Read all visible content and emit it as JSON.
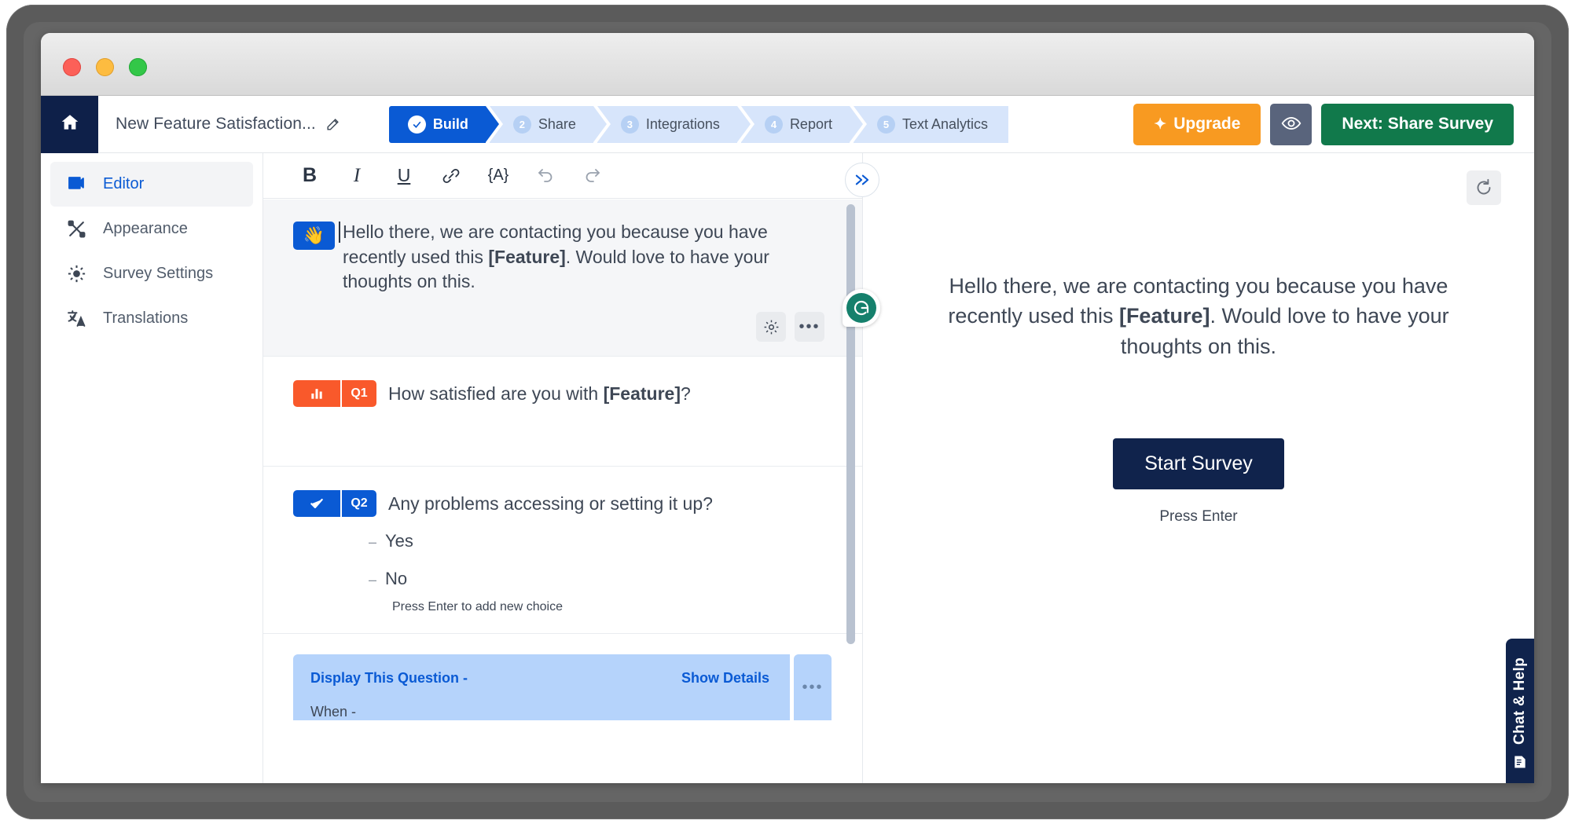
{
  "window": {
    "traffic_lights": [
      "close",
      "minimize",
      "maximize"
    ]
  },
  "header": {
    "home_icon": "home-icon",
    "survey_title": "New Feature Satisfaction...",
    "edit_icon": "pencil-icon",
    "steps": [
      {
        "num": "1",
        "label": "Build",
        "state": "complete"
      },
      {
        "num": "2",
        "label": "Share",
        "state": "pending"
      },
      {
        "num": "3",
        "label": "Integrations",
        "state": "pending"
      },
      {
        "num": "4",
        "label": "Report",
        "state": "pending"
      },
      {
        "num": "5",
        "label": "Text Analytics",
        "state": "pending"
      }
    ],
    "upgrade_label": "Upgrade",
    "upgrade_icon": "sparkle-icon",
    "preview_icon": "eye-icon",
    "next_label": "Next: Share Survey",
    "colors": {
      "upgrade_bg": "#f89a21",
      "preview_bg": "#59647c",
      "next_bg": "#11794b",
      "active_step_bg": "#0a5ad4",
      "inactive_step_bg": "#d7e5fb"
    }
  },
  "sidebar": {
    "items": [
      {
        "label": "Editor",
        "icon": "editor-icon",
        "active": true
      },
      {
        "label": "Appearance",
        "icon": "palette-brush-icon",
        "active": false
      },
      {
        "label": "Survey Settings",
        "icon": "gear-icon",
        "active": false
      },
      {
        "label": "Translations",
        "icon": "translate-icon",
        "active": false
      }
    ]
  },
  "editor": {
    "toolbar": [
      {
        "name": "bold",
        "label": "B"
      },
      {
        "name": "italic",
        "label": "I"
      },
      {
        "name": "underline",
        "label": "U"
      },
      {
        "name": "link",
        "label": "link-icon"
      },
      {
        "name": "piped-text",
        "label": "{A}"
      },
      {
        "name": "undo",
        "label": "undo-icon"
      },
      {
        "name": "redo",
        "label": "redo-icon"
      }
    ],
    "expand_icon": "double-chevron-right-icon",
    "welcome_block": {
      "emoji": "👋",
      "text_part1": "Hello there, we are contacting you because you have recently used this ",
      "text_bold": "[Feature]",
      "text_part2": ". Would love to have your thoughts on this.",
      "settings_icon": "gear-icon",
      "more_icon": "ellipsis-icon"
    },
    "questions": [
      {
        "num": "Q1",
        "type_icon": "bar-chart-icon",
        "color": "#f9592b",
        "text_part1": "How satisfied are you with ",
        "text_bold": "[Feature]",
        "text_part2": "?",
        "choices": []
      },
      {
        "num": "Q2",
        "type_icon": "checkmark-icon",
        "color": "#0a5ad4",
        "text_part1": "Any problems accessing or setting it up?",
        "text_bold": "",
        "text_part2": "",
        "choices": [
          "Yes",
          "No"
        ],
        "choice_hint": "Press Enter to add new choice"
      }
    ],
    "display_logic": {
      "label": "Display This Question -",
      "show_details": "Show Details",
      "when": "When -",
      "more_icon": "ellipsis-icon"
    },
    "grammarly_icon": "grammarly-icon"
  },
  "preview": {
    "refresh_icon": "refresh-icon",
    "text_part1": "Hello there, we are contacting you because you have recently used this ",
    "text_bold": "[Feature]",
    "text_part2": ". Would love to have your thoughts on this.",
    "start_button": "Start Survey",
    "press_enter": "Press Enter",
    "start_button_bg": "#10234c"
  },
  "chat_tab": {
    "label": "Chat & Help",
    "icon": "chat-document-icon",
    "bg": "#10234c"
  }
}
